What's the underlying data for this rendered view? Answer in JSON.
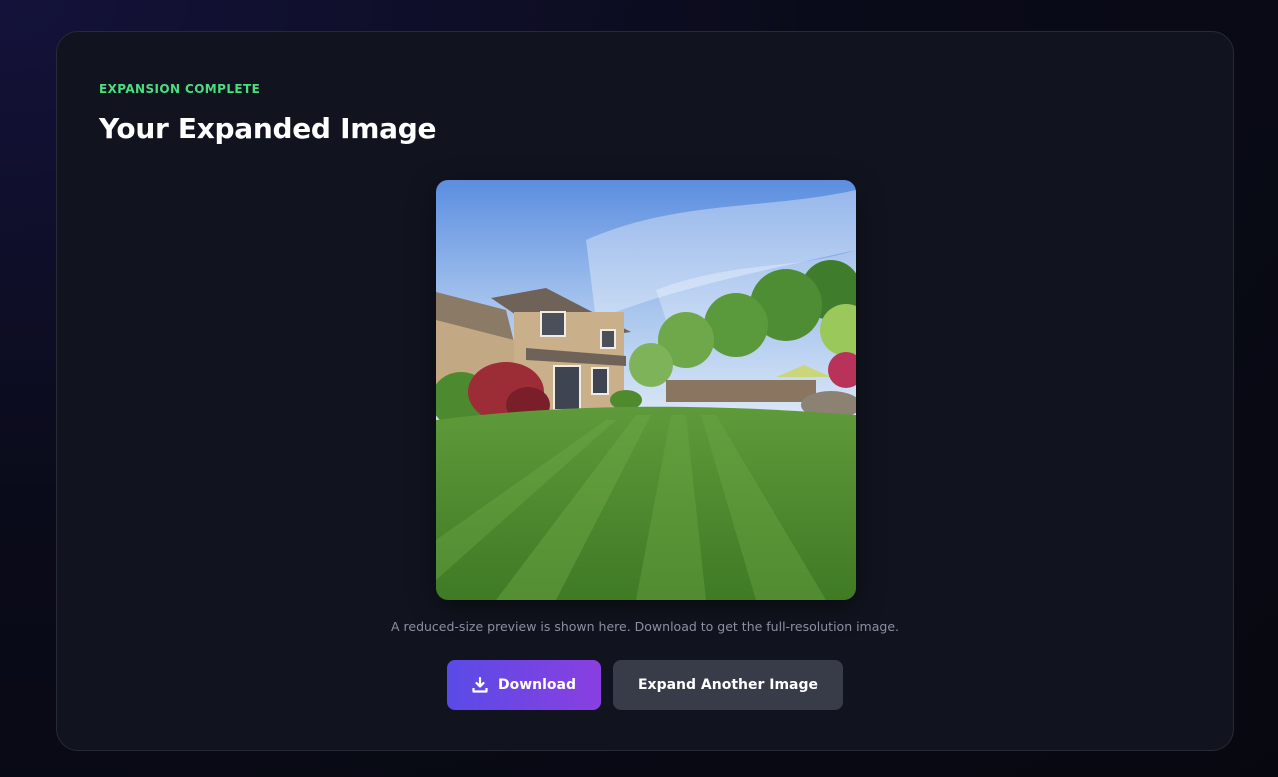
{
  "header": {
    "eyebrow": "EXPANSION COMPLETE",
    "title": "Your Expanded Image"
  },
  "preview": {
    "caption": "A reduced-size preview is shown here. Download to get the full-resolution image."
  },
  "actions": {
    "download_label": "Download",
    "download_icon": "download-icon",
    "expand_another_label": "Expand Another Image"
  },
  "colors": {
    "accent_green": "#4ade80",
    "primary_gradient_start": "#5a4be6",
    "primary_gradient_end": "#8a3fe0",
    "card_background": "#11141f",
    "secondary_button": "#383c48"
  }
}
